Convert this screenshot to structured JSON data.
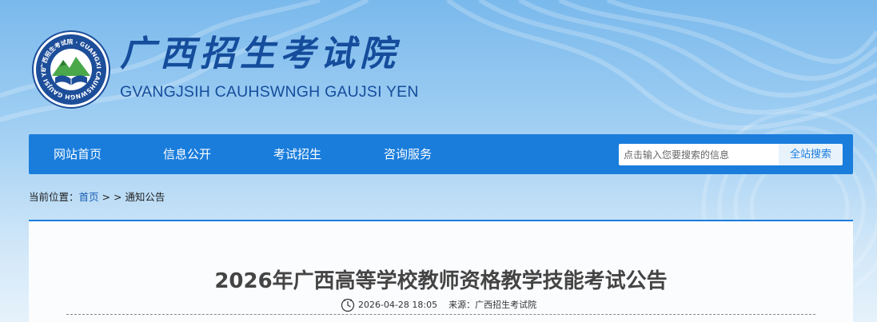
{
  "header": {
    "title": "广西招生考试院",
    "subtitle": "GVANGJSIH CAUHSWNGH GAUJSI YEN",
    "logo_ring_text": "广西招生考试院 · GUANGXI CAUHSWNGH GAUJSI YEN"
  },
  "nav": {
    "items": [
      {
        "label": "网站首页"
      },
      {
        "label": "信息公开"
      },
      {
        "label": "考试招生"
      },
      {
        "label": "咨询服务"
      }
    ],
    "search": {
      "placeholder": "点击输入您要搜索的信息",
      "button_label": "全站搜索"
    }
  },
  "breadcrumb": {
    "prefix": "当前位置：",
    "home": "首页",
    "separator": " > > ",
    "current": "通知公告"
  },
  "article": {
    "title": "2026年广西高等学校教师资格教学技能考试公告",
    "datetime": "2026-04-28 18:05",
    "source": "来源：广西招生考试院"
  },
  "colors": {
    "nav_bg": "#1a7ddc",
    "title_blue": "#154d9c",
    "logo_ring": "#1d4e9a"
  }
}
